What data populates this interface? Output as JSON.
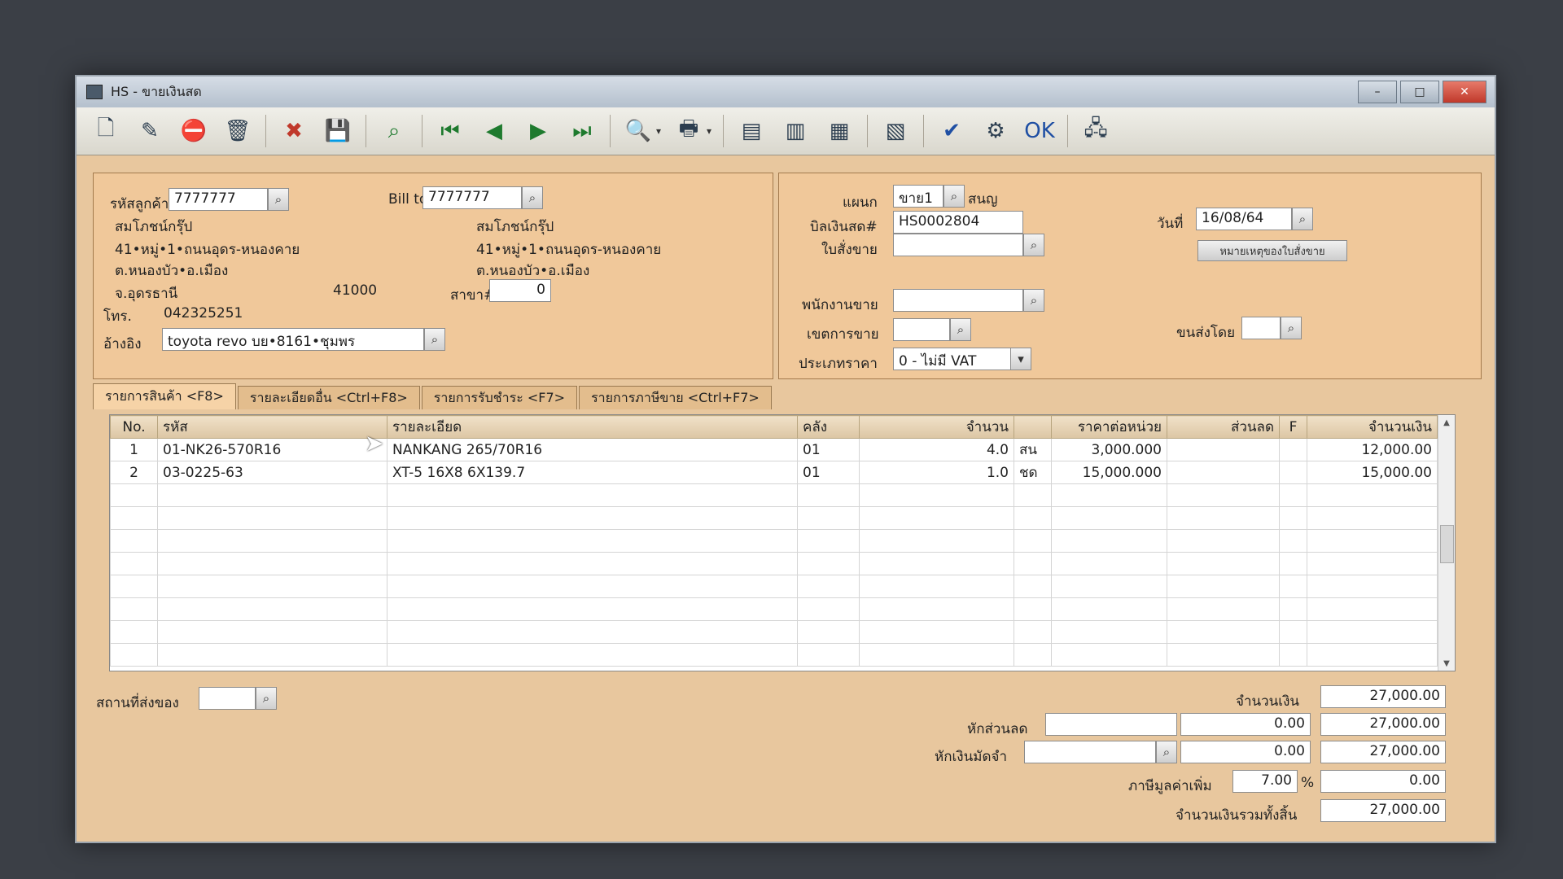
{
  "window": {
    "title": "HS - ขายเงินสด",
    "minimize": "–",
    "maximize": "□",
    "close": "✕"
  },
  "toolbar": [
    {
      "name": "new-icon",
      "glyph": "🗋"
    },
    {
      "name": "edit-icon",
      "glyph": "✎"
    },
    {
      "name": "void-icon",
      "glyph": "⛔"
    },
    {
      "name": "delete-icon",
      "glyph": "🗑"
    },
    {
      "name": "cancel-icon",
      "glyph": "✖"
    },
    {
      "name": "save-icon",
      "glyph": "💾"
    },
    {
      "name": "search-records-icon",
      "glyph": "⌕"
    },
    {
      "name": "first-record-icon",
      "glyph": "⏮"
    },
    {
      "name": "previous-record-icon",
      "glyph": "◀"
    },
    {
      "name": "next-record-icon",
      "glyph": "▶"
    },
    {
      "name": "last-record-icon",
      "glyph": "⏭"
    },
    {
      "name": "preview-icon",
      "glyph": "🔍"
    },
    {
      "name": "print-icon",
      "glyph": "🖶"
    },
    {
      "name": "report-1-icon",
      "glyph": "▤"
    },
    {
      "name": "report-2-icon",
      "glyph": "▥"
    },
    {
      "name": "report-3-icon",
      "glyph": "▦"
    },
    {
      "name": "calculator-icon",
      "glyph": "▧"
    },
    {
      "name": "approve-icon",
      "glyph": "✔"
    },
    {
      "name": "link-icon",
      "glyph": "⚙"
    },
    {
      "name": "ok-icon",
      "glyph": "OK"
    },
    {
      "name": "network-icon",
      "glyph": "🖧"
    }
  ],
  "customer": {
    "code_label": "รหัสลูกค้า",
    "code": "7777777",
    "name": "สมโภชน์กรุ๊ป",
    "addr1": "41•หมู่•1•ถนนอุดร-หนองคาย",
    "addr2": "ต.หนองบัว•อ.เมือง",
    "province": "จ.อุดรธานี",
    "postcode": "41000",
    "phone_label": "โทร.",
    "phone": "042325251",
    "ref_label": "อ้างอิง",
    "ref": "toyota revo บย•8161•ชุมพร"
  },
  "billto": {
    "label": "Bill to",
    "code": "7777777",
    "name": "สมโภชน์กรุ๊ป",
    "addr1": "41•หมู่•1•ถนนอุดร-หนองคาย",
    "addr2": "ต.หนองบัว•อ.เมือง",
    "branch_label": "สาขา#",
    "branch": "0"
  },
  "doc": {
    "dept_label": "แผนก",
    "dept": "ขาย1",
    "dept_name": "สนญ",
    "bill_label": "บิลเงินสด#",
    "bill": "HS0002804",
    "date_label": "วันที่",
    "date": "16/08/64",
    "so_label": "ใบสั่งขาย",
    "so": "",
    "note_button": "หมายเหตุของใบสั่งขาย",
    "salesman_label": "พนักงานขาย",
    "salesman": "",
    "area_label": "เขตการขาย",
    "area": "",
    "ship_label": "ขนส่งโดย",
    "ship": "",
    "price_type_label": "ประเภทราคา",
    "price_type": "0 - ไม่มี VAT"
  },
  "tabs": [
    "รายการสินค้า <F8>",
    "รายละเอียดอื่น <Ctrl+F8>",
    "รายการรับชำระ <F7>",
    "รายการภาษีขาย <Ctrl+F7>"
  ],
  "columns": [
    "No.",
    "รหัส",
    "รายละเอียด",
    "คลัง",
    "จำนวน",
    "",
    "ราคาต่อหน่วย",
    "ส่วนลด",
    "F",
    "จำนวนเงิน"
  ],
  "rows": [
    [
      "1",
      "01-NK26-570R16",
      "NANKANG 265/70R16",
      "01",
      "4.0",
      "สน",
      "3,000.000",
      "",
      "",
      "12,000.00"
    ],
    [
      "2",
      "03-0225-63",
      "XT-5 16X8 6X139.7",
      "01",
      "1.0",
      "ชด",
      "15,000.000",
      "",
      "",
      "15,000.00"
    ]
  ],
  "footer": {
    "deliver_label": "สถานที่ส่งของ",
    "deliver": "",
    "amount_label": "จำนวนเงิน",
    "amount": "27,000.00",
    "discount_label": "หักส่วนลด",
    "discount_text": "",
    "discount_value": "0.00",
    "discount_total": "27,000.00",
    "deposit_label": "หักเงินมัดจำ",
    "deposit_text": "",
    "deposit_value": "0.00",
    "deposit_total": "27,000.00",
    "vat_label": "ภาษีมูลค่าเพิ่ม",
    "vat_rate": "7.00",
    "vat_pct": "%",
    "vat_value": "0.00",
    "grand_label": "จำนวนเงินรวมทั้งสิ้น",
    "grand": "27,000.00"
  }
}
